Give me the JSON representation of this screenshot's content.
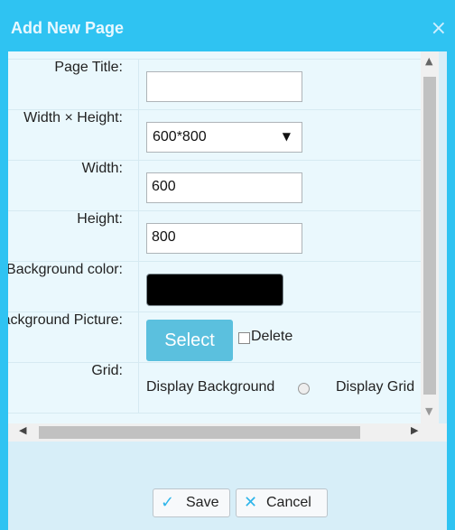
{
  "dialog": {
    "title": "Add New Page",
    "close_icon": "×"
  },
  "form": {
    "page_title": {
      "label": "Page Title:",
      "value": ""
    },
    "size": {
      "label": "Width × Height:",
      "value": "600*800",
      "arrow": "▼"
    },
    "width": {
      "label": "Width:",
      "value": "600"
    },
    "height": {
      "label": "Height:",
      "value": "800"
    },
    "background_color": {
      "label": "Background color:",
      "value": "#000000"
    },
    "background_picture": {
      "label": "Background Picture:",
      "select_label": "Select",
      "delete_label": "Delete"
    },
    "grid": {
      "label": "Grid:",
      "option1": "Display Background",
      "option2": "Display Grid"
    }
  },
  "scroll": {
    "up": "▲",
    "down": "▼",
    "left": "◀",
    "right": "▶"
  },
  "footer": {
    "save_icon": "✓",
    "save_label": "Save",
    "cancel_icon": "✕",
    "cancel_label": "Cancel"
  },
  "colors": {
    "frame": "#2fc3f2",
    "select_button": "#5bc0de",
    "panel": "#eaf8fd"
  }
}
